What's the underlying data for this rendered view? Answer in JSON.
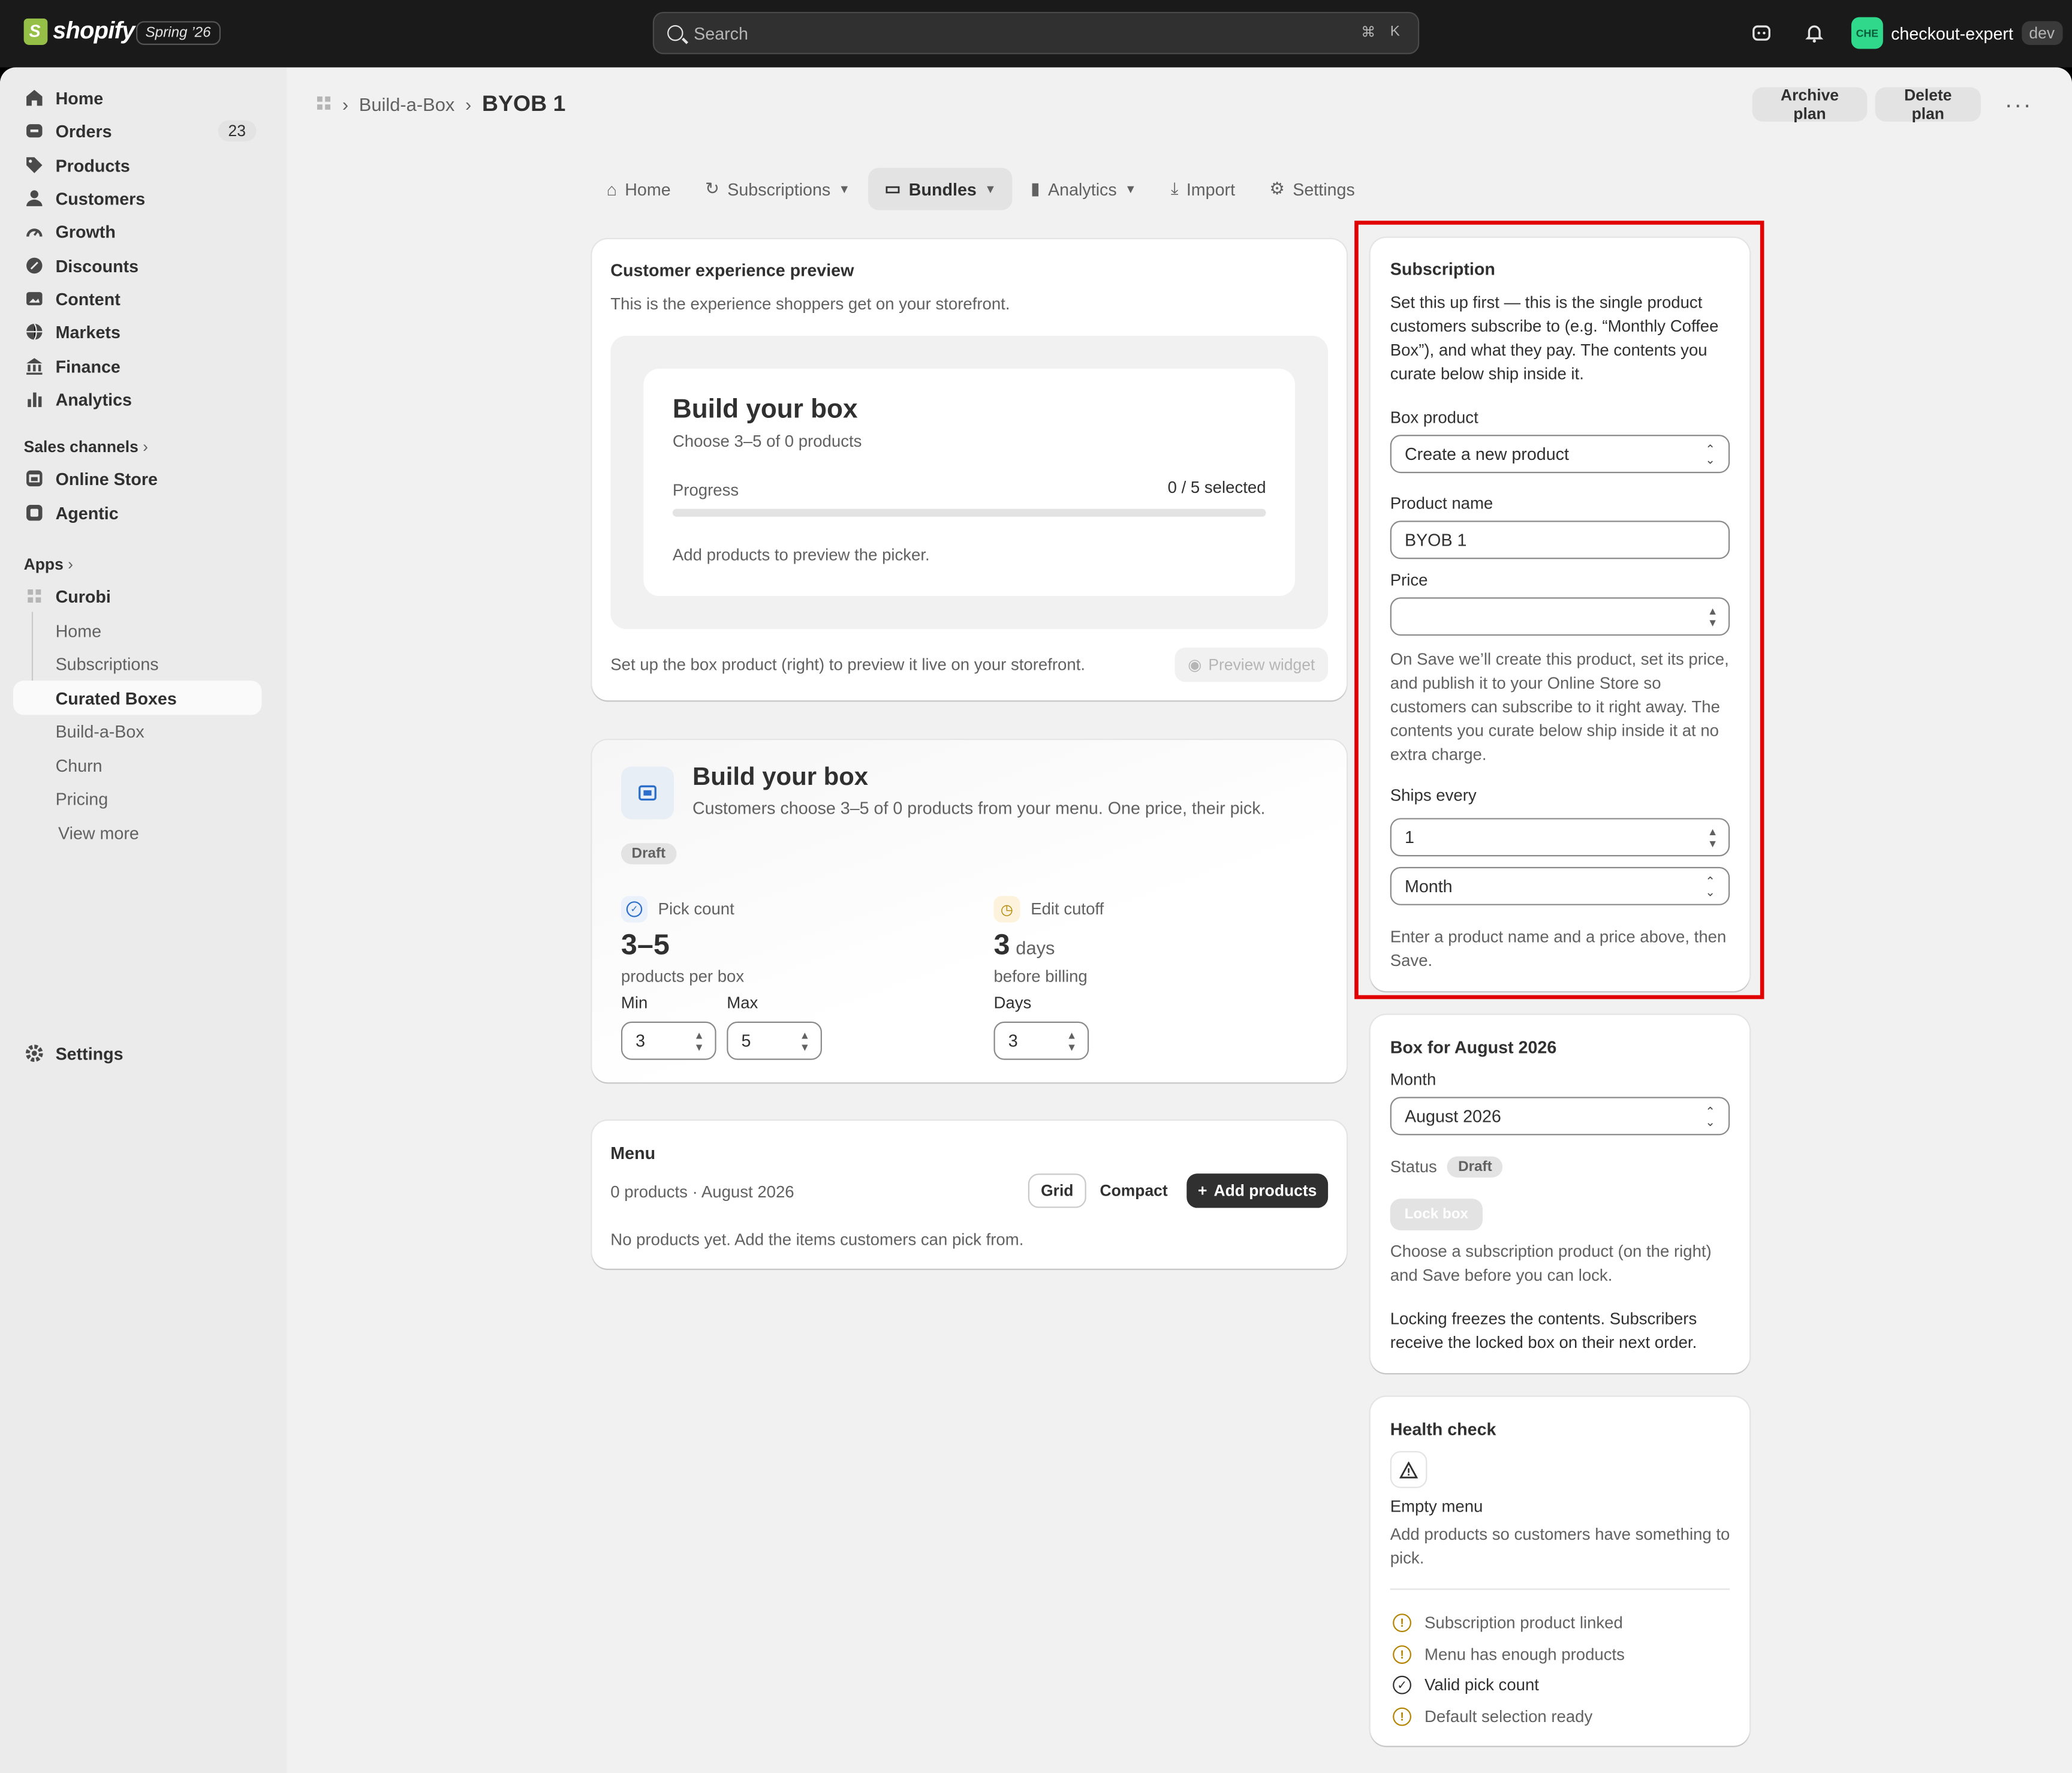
{
  "topbar": {
    "logo_text": "shopify",
    "release_badge": "Spring ’26",
    "search_placeholder": "Search",
    "shortcut_cmd": "⌘",
    "shortcut_key": "K",
    "store_initials": "CHE",
    "store_name": "checkout-expert",
    "env_badge": "dev"
  },
  "sidebar": {
    "items": [
      {
        "label": "Home",
        "icon": "home-icon"
      },
      {
        "label": "Orders",
        "icon": "orders-icon",
        "count": "23"
      },
      {
        "label": "Products",
        "icon": "tag-icon"
      },
      {
        "label": "Customers",
        "icon": "person-icon"
      },
      {
        "label": "Growth",
        "icon": "gauge-icon"
      },
      {
        "label": "Discounts",
        "icon": "discount-icon"
      },
      {
        "label": "Content",
        "icon": "content-icon"
      },
      {
        "label": "Markets",
        "icon": "globe-icon"
      },
      {
        "label": "Finance",
        "icon": "bank-icon"
      },
      {
        "label": "Analytics",
        "icon": "bar-chart-icon"
      }
    ],
    "sales_channels_label": "Sales channels",
    "channels": [
      {
        "label": "Online Store",
        "icon": "store-icon"
      },
      {
        "label": "Agentic",
        "icon": "agentic-icon"
      }
    ],
    "apps_label": "Apps",
    "app_name": "Curobi",
    "app_items": [
      "Home",
      "Subscriptions",
      "Curated Boxes",
      "Build-a-Box",
      "Churn",
      "Pricing",
      "View more"
    ],
    "settings_label": "Settings"
  },
  "header": {
    "breadcrumb_parent": "Build-a-Box",
    "title": "BYOB 1",
    "archive_label": "Archive plan",
    "delete_label": "Delete plan"
  },
  "tabs": [
    {
      "label": "Home"
    },
    {
      "label": "Subscriptions"
    },
    {
      "label": "Bundles"
    },
    {
      "label": "Analytics"
    },
    {
      "label": "Import"
    },
    {
      "label": "Settings"
    }
  ],
  "preview": {
    "title": "Customer experience preview",
    "subtitle": "This is the experience shoppers get on your storefront.",
    "box_title": "Build your box",
    "box_sub": "Choose 3–5 of 0 products",
    "progress_label": "Progress",
    "progress_value": "0 / 5 selected",
    "progress_fraction": 0,
    "empty_text": "Add products to preview the picker.",
    "footer_text": "Set up the box product (right) to preview it live on your storefront.",
    "preview_button": "Preview widget"
  },
  "plan": {
    "title": "Build your box",
    "description": "Customers choose 3–5 of 0 products from your menu. One price, their pick.",
    "status": "Draft",
    "pick_label": "Pick count",
    "pick_value": "3–5",
    "pick_unit": "products per box",
    "min_label": "Min",
    "min_value": "3",
    "max_label": "Max",
    "max_value": "5",
    "cutoff_label": "Edit cutoff",
    "cutoff_value": "3",
    "cutoff_unit": "days",
    "cutoff_sub": "before billing",
    "days_label": "Days",
    "days_value": "3"
  },
  "menu": {
    "title": "Menu",
    "summary": "0 products · August 2026",
    "grid_label": "Grid",
    "compact_label": "Compact",
    "add_label": "Add products",
    "empty_text": "No products yet. Add the items customers can pick from."
  },
  "subscription": {
    "title": "Subscription",
    "intro": "Set this up first — this is the single product customers subscribe to (e.g. “Monthly Coffee Box”), and what they pay. The contents you curate below ship inside it.",
    "box_product_label": "Box product",
    "box_product_value": "Create a new product",
    "product_name_label": "Product name",
    "product_name_value": "BYOB 1",
    "price_label": "Price",
    "price_value": "",
    "save_note": "On Save we’ll create this product, set its price, and publish it to your Online Store so customers can subscribe to it right away. The contents you curate below ship inside it at no extra charge.",
    "ships_label": "Ships every",
    "ships_value": "1",
    "interval_value": "Month",
    "hint": "Enter a product name and a price above, then Save."
  },
  "box_month": {
    "title": "Box for August 2026",
    "month_label": "Month",
    "month_value": "August 2026",
    "status_label": "Status",
    "status_value": "Draft",
    "lock_label": "Lock box",
    "lock_note": "Choose a subscription product (on the right) and Save before you can lock.",
    "locking_note": "Locking freezes the contents. Subscribers receive the locked box on their next order."
  },
  "health": {
    "title": "Health check",
    "issue_title": "Empty menu",
    "issue_desc": "Add products so customers have something to pick.",
    "checks": [
      {
        "label": "Subscription product linked",
        "state": "warning"
      },
      {
        "label": "Menu has enough products",
        "state": "warning"
      },
      {
        "label": "Valid pick count",
        "state": "ok"
      },
      {
        "label": "Default selection ready",
        "state": "warning"
      }
    ]
  },
  "colors": {
    "highlight": "#e00000",
    "warning": "#b28400",
    "topbar": "#1a1a1a"
  }
}
